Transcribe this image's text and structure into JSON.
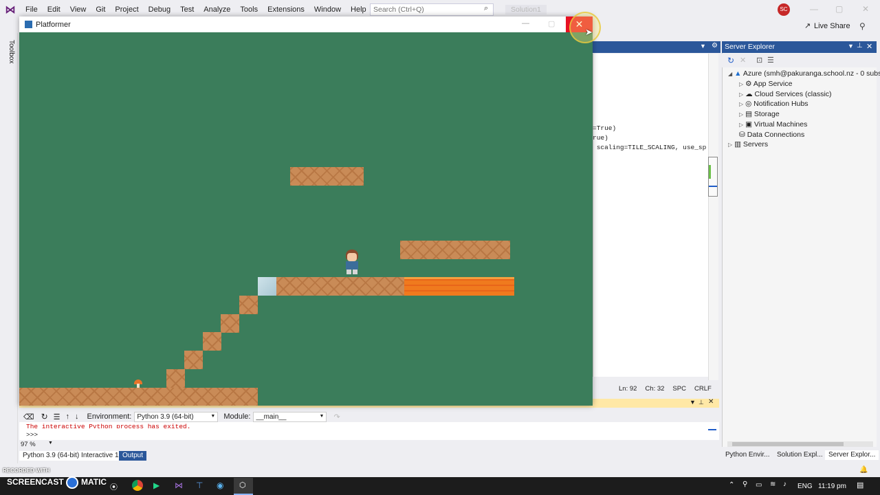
{
  "vs": {
    "menus": [
      "File",
      "Edit",
      "View",
      "Git",
      "Project",
      "Debug",
      "Test",
      "Analyze",
      "Tools",
      "Extensions",
      "Window",
      "Help"
    ],
    "search_placeholder": "Search (Ctrl+Q)",
    "solution": "Solution1",
    "avatar": "SC",
    "live_share": "Live Share",
    "toolbox": "Toolbox"
  },
  "editor": {
    "lines": [
      "=True)",
      "rue)",
      " scaling=TILE_SCALING, use_sp"
    ],
    "status": {
      "ln": "Ln: 92",
      "ch": "Ch: 32",
      "spc": "SPC",
      "crlf": "CRLF"
    }
  },
  "server_explorer": {
    "title": "Server Explorer",
    "items": [
      {
        "label": "Azure (smh@pakuranga.school.nz - 0 subs"
      },
      {
        "label": "App Service"
      },
      {
        "label": "Cloud Services (classic)"
      },
      {
        "label": "Notification Hubs"
      },
      {
        "label": "Storage"
      },
      {
        "label": "Virtual Machines"
      },
      {
        "label": "Data Connections"
      },
      {
        "label": "Servers"
      }
    ],
    "bottom_tabs": [
      "Python Envir...",
      "Solution Expl...",
      "Server Explor..."
    ]
  },
  "interactive": {
    "environment_label": "Environment:",
    "environment_value": "Python 3.9 (64-bit)",
    "module_label": "Module:",
    "module_value": "__main__",
    "output_line1": "The interactive Python process has exited.",
    "prompt": ">>>",
    "zoom": "97 %",
    "tabs": [
      "Python 3.9 (64-bit) Interactive 1",
      "Output"
    ]
  },
  "platformer": {
    "title": "Platformer",
    "close_label": "✕"
  },
  "watermark": {
    "recorded": "RECORDED WITH",
    "brand": "SCREENCAST",
    "brand2": "MATIC"
  },
  "taskbar": {
    "lang": "ENG",
    "time": "11:19 pm"
  },
  "colors": {
    "game_bg": "#3b7d5b",
    "crate": "#c98b57",
    "lava": "#f07a1e",
    "vs_accent": "#2b579a",
    "close_red": "#e81123"
  }
}
